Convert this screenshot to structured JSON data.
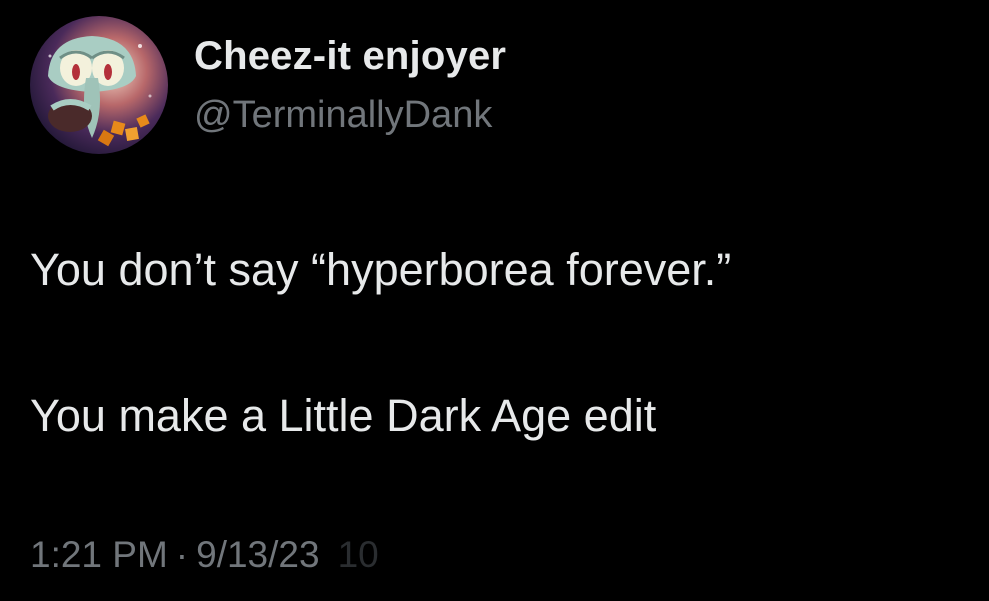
{
  "author": {
    "display_name": "Cheez-it enjoyer",
    "handle": "@TerminallyDank",
    "avatar_icon": "squidward-avatar-icon"
  },
  "tweet": {
    "line_1": "You don’t say “hyperborea forever.”",
    "line_2": "You make a Little Dark Age edit"
  },
  "meta": {
    "time": "1:21 PM",
    "separator": "·",
    "date": "9/13/23",
    "views_partial": "10"
  },
  "colors": {
    "background": "#000000",
    "primary_text": "#e7e9ea",
    "secondary_text": "#71767b"
  }
}
